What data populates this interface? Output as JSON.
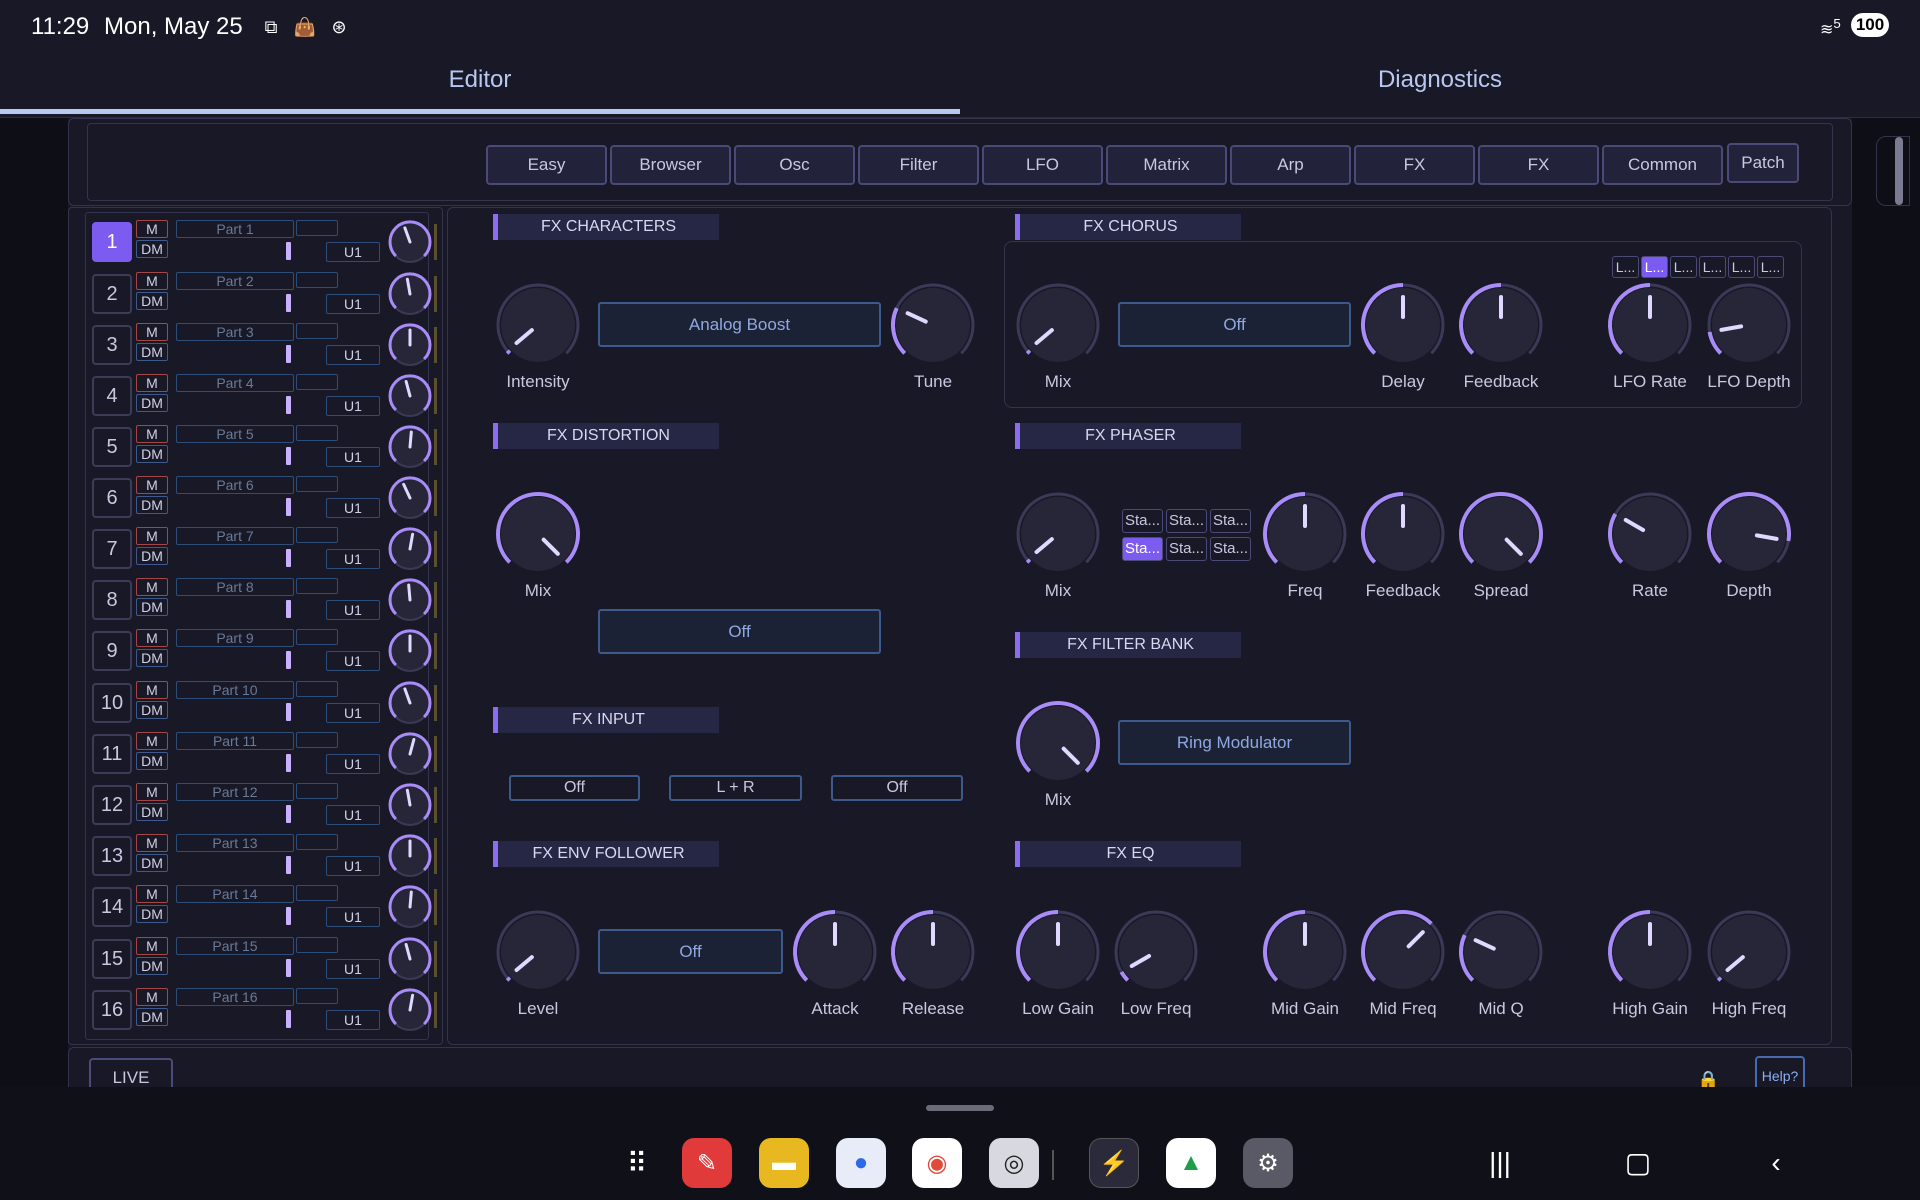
{
  "status_bar": {
    "time": "11:29",
    "date": "Mon, May 25",
    "battery": "100",
    "wifi_label": "5"
  },
  "tabs": [
    {
      "label": "Editor",
      "active": true
    },
    {
      "label": "Diagnostics",
      "active": false
    }
  ],
  "nav_buttons": [
    "Easy",
    "Browser",
    "Osc",
    "Filter",
    "LFO",
    "Matrix",
    "Arp",
    "FX",
    "FX",
    "Common",
    "Patch"
  ],
  "parts": [
    {
      "num": "1",
      "name": "Part 1",
      "unit": "U1",
      "m": "M",
      "dm": "DM"
    },
    {
      "num": "2",
      "name": "Part 2",
      "unit": "U1",
      "m": "M",
      "dm": "DM"
    },
    {
      "num": "3",
      "name": "Part 3",
      "unit": "U1",
      "m": "M",
      "dm": "DM"
    },
    {
      "num": "4",
      "name": "Part 4",
      "unit": "U1",
      "m": "M",
      "dm": "DM"
    },
    {
      "num": "5",
      "name": "Part 5",
      "unit": "U1",
      "m": "M",
      "dm": "DM"
    },
    {
      "num": "6",
      "name": "Part 6",
      "unit": "U1",
      "m": "M",
      "dm": "DM"
    },
    {
      "num": "7",
      "name": "Part 7",
      "unit": "U1",
      "m": "M",
      "dm": "DM"
    },
    {
      "num": "8",
      "name": "Part 8",
      "unit": "U1",
      "m": "M",
      "dm": "DM"
    },
    {
      "num": "9",
      "name": "Part 9",
      "unit": "U1",
      "m": "M",
      "dm": "DM"
    },
    {
      "num": "10",
      "name": "Part 10",
      "unit": "U1",
      "m": "M",
      "dm": "DM"
    },
    {
      "num": "11",
      "name": "Part 11",
      "unit": "U1",
      "m": "M",
      "dm": "DM"
    },
    {
      "num": "12",
      "name": "Part 12",
      "unit": "U1",
      "m": "M",
      "dm": "DM"
    },
    {
      "num": "13",
      "name": "Part 13",
      "unit": "U1",
      "m": "M",
      "dm": "DM"
    },
    {
      "num": "14",
      "name": "Part 14",
      "unit": "U1",
      "m": "M",
      "dm": "DM"
    },
    {
      "num": "15",
      "name": "Part 15",
      "unit": "U1",
      "m": "M",
      "dm": "DM"
    },
    {
      "num": "16",
      "name": "Part 16",
      "unit": "U1",
      "m": "M",
      "dm": "DM"
    }
  ],
  "sections": {
    "characters": "FX CHARACTERS",
    "chorus": "FX CHORUS",
    "distortion": "FX DISTORTION",
    "phaser": "FX PHASER",
    "filter_bank": "FX FILTER BANK",
    "input": "FX INPUT",
    "env_follower": "FX ENV FOLLOWER",
    "eq": "FX EQ"
  },
  "characters": {
    "intensity": "Intensity",
    "tune": "Tune",
    "type": "Analog Boost"
  },
  "chorus": {
    "mix": "Mix",
    "mode": "Off",
    "delay": "Delay",
    "feedback": "Feedback",
    "lfo_rate": "LFO Rate",
    "lfo_depth": "LFO Depth",
    "lfo_buttons": [
      "L...",
      "L...",
      "L...",
      "L...",
      "L...",
      "L..."
    ]
  },
  "distortion": {
    "mix": "Mix",
    "type": "Off"
  },
  "phaser": {
    "mix": "Mix",
    "freq": "Freq",
    "feedback": "Feedback",
    "spread": "Spread",
    "rate": "Rate",
    "depth": "Depth",
    "stage_buttons": [
      "Sta...",
      "Sta...",
      "Sta...",
      "Sta...",
      "Sta...",
      "Sta..."
    ]
  },
  "filter_bank": {
    "mix": "Mix",
    "type": "Ring Modulator"
  },
  "input": {
    "left": "Off",
    "mid": "L + R",
    "right": "Off"
  },
  "env_follower": {
    "level": "Level",
    "mode": "Off",
    "attack": "Attack",
    "release": "Release"
  },
  "eq": {
    "low_gain": "Low Gain",
    "low_freq": "Low Freq",
    "mid_gain": "Mid Gain",
    "mid_freq": "Mid Freq",
    "mid_q": "Mid Q",
    "high_gain": "High Gain",
    "high_freq": "High Freq"
  },
  "footer": {
    "live": "LIVE",
    "help": "Help?"
  },
  "colors": {
    "accent": "#7c5cf0",
    "knob_ring": "#a98cf8",
    "background": "#181826"
  },
  "dock_icons": [
    "app-grid-icon",
    "notes-app-icon",
    "files-app-icon",
    "messages-app-icon",
    "chrome-app-icon",
    "camera-app-icon",
    "synth-app-icon",
    "drive-app-icon",
    "settings-app-icon"
  ]
}
